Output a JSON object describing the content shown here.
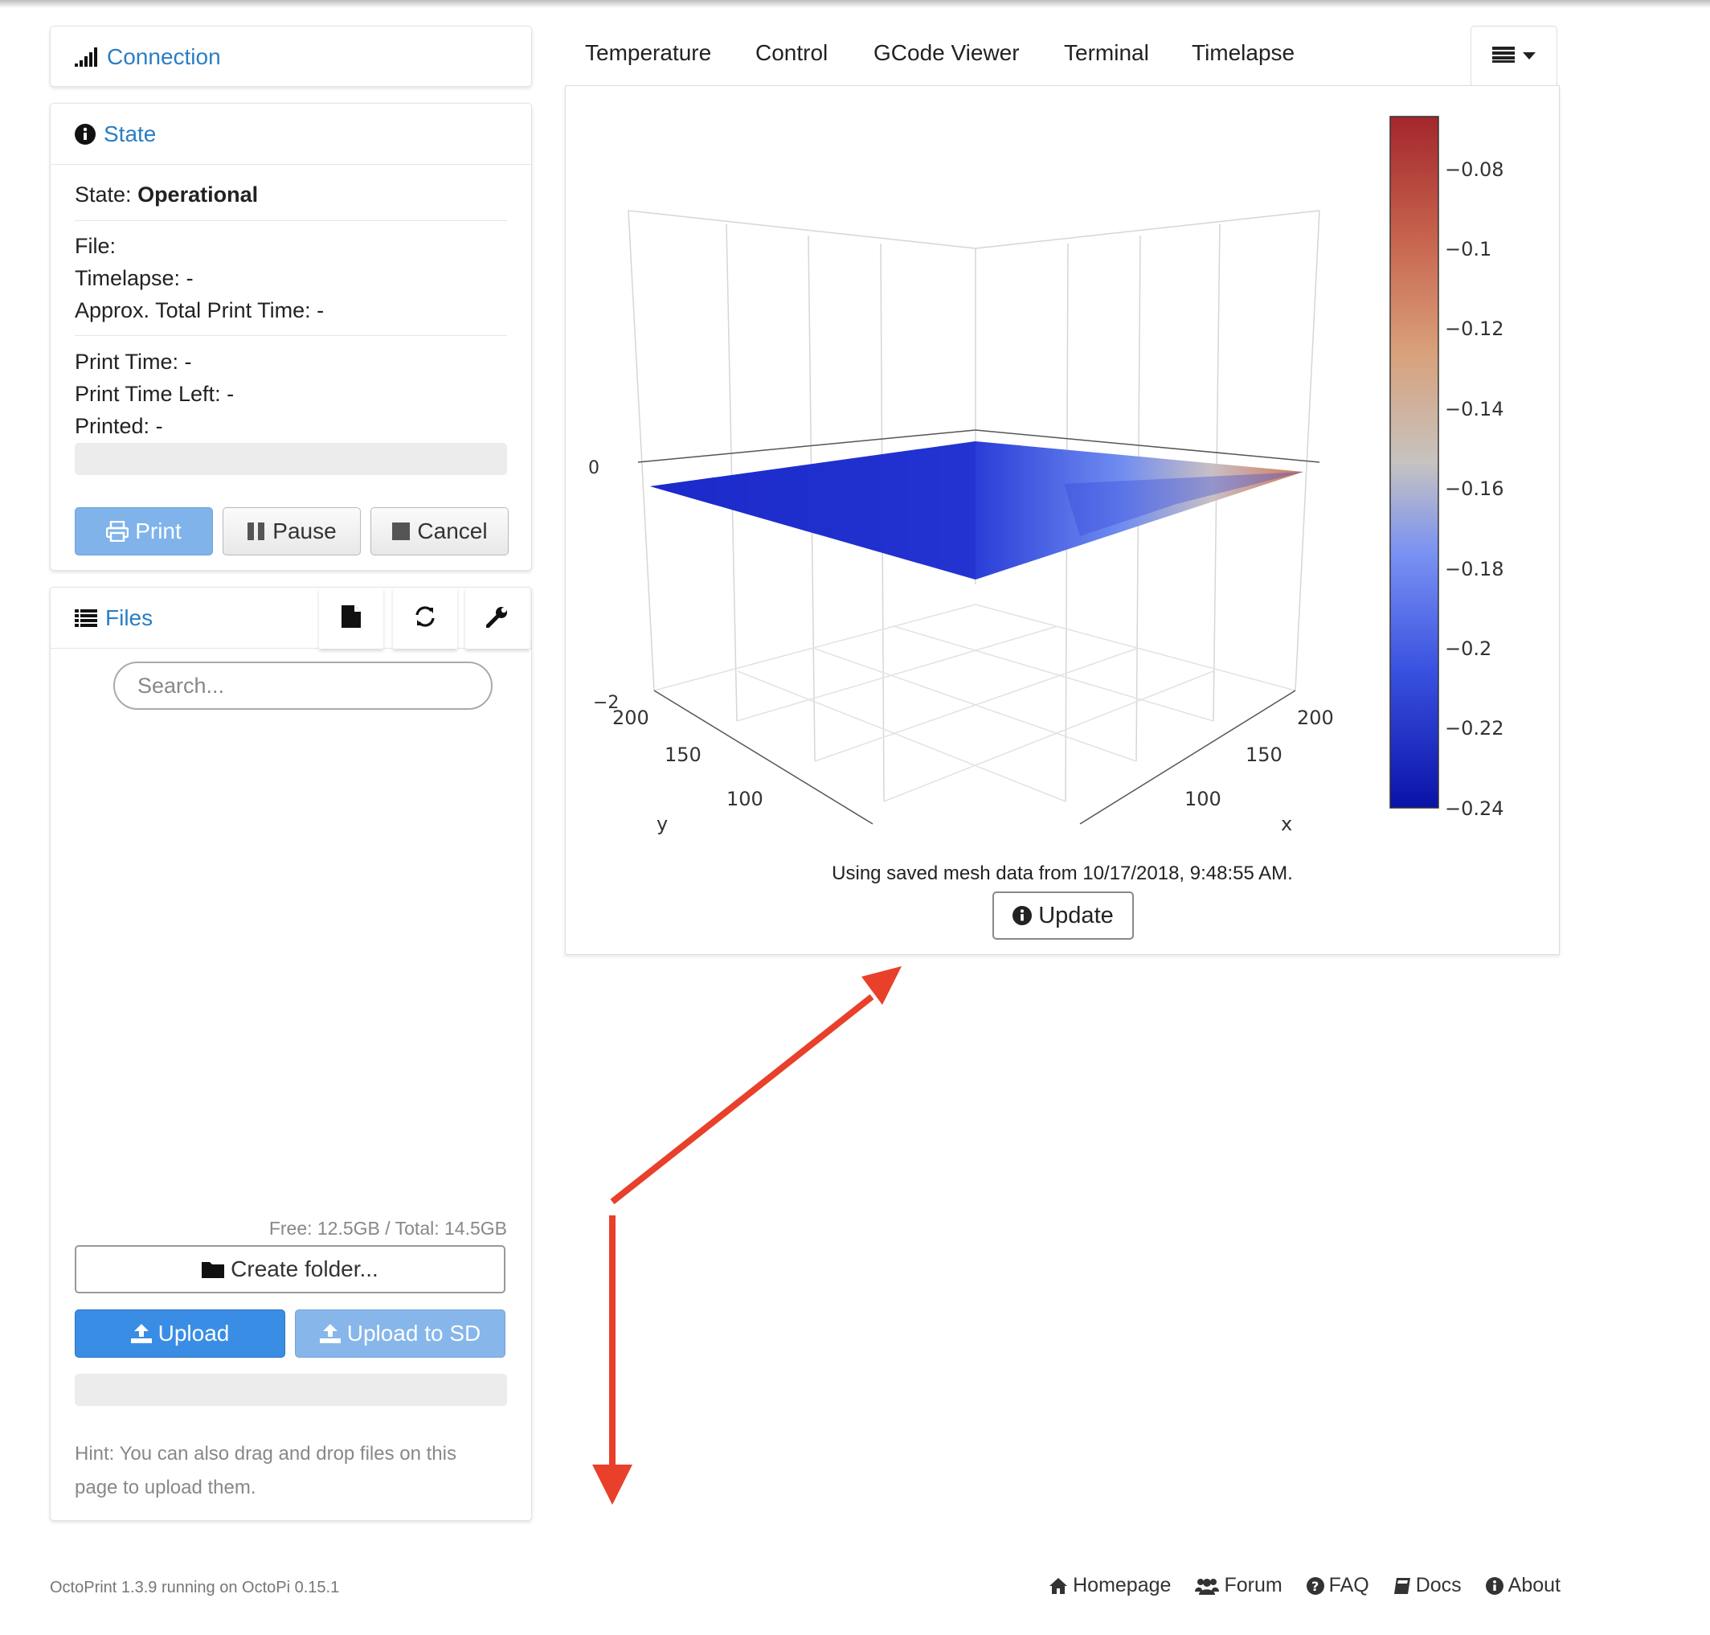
{
  "sidebar": {
    "connection": {
      "title": "Connection",
      "icon": "signal-icon"
    },
    "state": {
      "title": "State",
      "icon": "info-circle-icon",
      "state_label": "State:",
      "state_value": "Operational",
      "file_label": "File:",
      "file_value": "",
      "timelapse_label": "Timelapse:",
      "timelapse_value": "-",
      "approx_label": "Approx. Total Print Time:",
      "approx_value": "-",
      "print_time_label": "Print Time:",
      "print_time_value": "-",
      "time_left_label": "Print Time Left:",
      "time_left_value": "-",
      "printed_label": "Printed:",
      "printed_value": "-",
      "progress": 0,
      "buttons": {
        "print": "Print",
        "pause": "Pause",
        "cancel": "Cancel"
      }
    },
    "files": {
      "title": "Files",
      "icon": "list-icon",
      "search_placeholder": "Search...",
      "free_space": "Free: 12.5GB / Total: 14.5GB",
      "create_folder": "Create folder...",
      "upload": "Upload",
      "upload_sd": "Upload to SD",
      "upload_progress": 0,
      "hint_line1": "Hint: You can also drag and drop files on this",
      "hint_line2": "page to upload them."
    }
  },
  "tabs": [
    {
      "label": "Temperature"
    },
    {
      "label": "Control"
    },
    {
      "label": "GCode Viewer"
    },
    {
      "label": "Terminal"
    },
    {
      "label": "Timelapse"
    }
  ],
  "mesh": {
    "caption": "Using saved mesh data from 10/17/2018, 9:48:55 AM.",
    "update_button": "Update",
    "z_ticks": [
      "0",
      "−2"
    ],
    "y_ticks": [
      "200",
      "150",
      "100"
    ],
    "x_ticks": [
      "200",
      "150",
      "100"
    ],
    "y_axis_label": "y",
    "x_axis_label": "x",
    "colorbar": {
      "ticks": [
        "−0.08",
        "−0.1",
        "−0.12",
        "−0.14",
        "−0.16",
        "−0.18",
        "−0.2",
        "−0.22",
        "−0.24"
      ],
      "colors": [
        "#a3262c",
        "#c8654f",
        "#d9a07a",
        "#c6c3c0",
        "#7a92f2",
        "#3a52e0",
        "#0a12a8"
      ]
    }
  },
  "footer": {
    "version": "OctoPrint 1.3.9 running on OctoPi 0.15.1",
    "links": [
      "Homepage",
      "Forum",
      "FAQ",
      "Docs",
      "About"
    ]
  },
  "annotation_color": "#e8402a"
}
